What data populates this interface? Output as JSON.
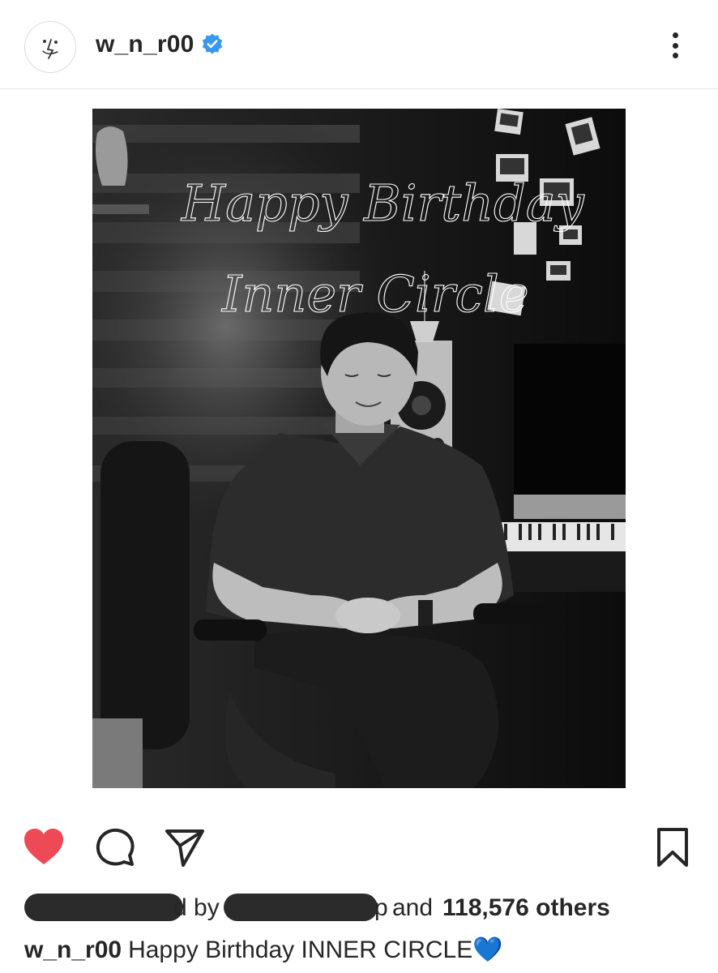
{
  "header": {
    "username": "w_n_r00",
    "verified": true,
    "more_icon": "more-vertical-icon"
  },
  "post": {
    "image_overlay_line1": "Happy Birthday",
    "image_overlay_line2": "Inner Circle"
  },
  "actions": {
    "like_icon": "heart-filled-icon",
    "comment_icon": "comment-icon",
    "share_icon": "send-icon",
    "save_icon": "bookmark-icon",
    "liked": true,
    "like_color": "#ed4956"
  },
  "likes": {
    "by_prefix": "d by",
    "and_text": "and",
    "others_count": "118,576 others",
    "third_fragment": "p"
  },
  "caption": {
    "username": "w_n_r00",
    "text": "Happy Birthday INNER CIRCLE💙"
  }
}
